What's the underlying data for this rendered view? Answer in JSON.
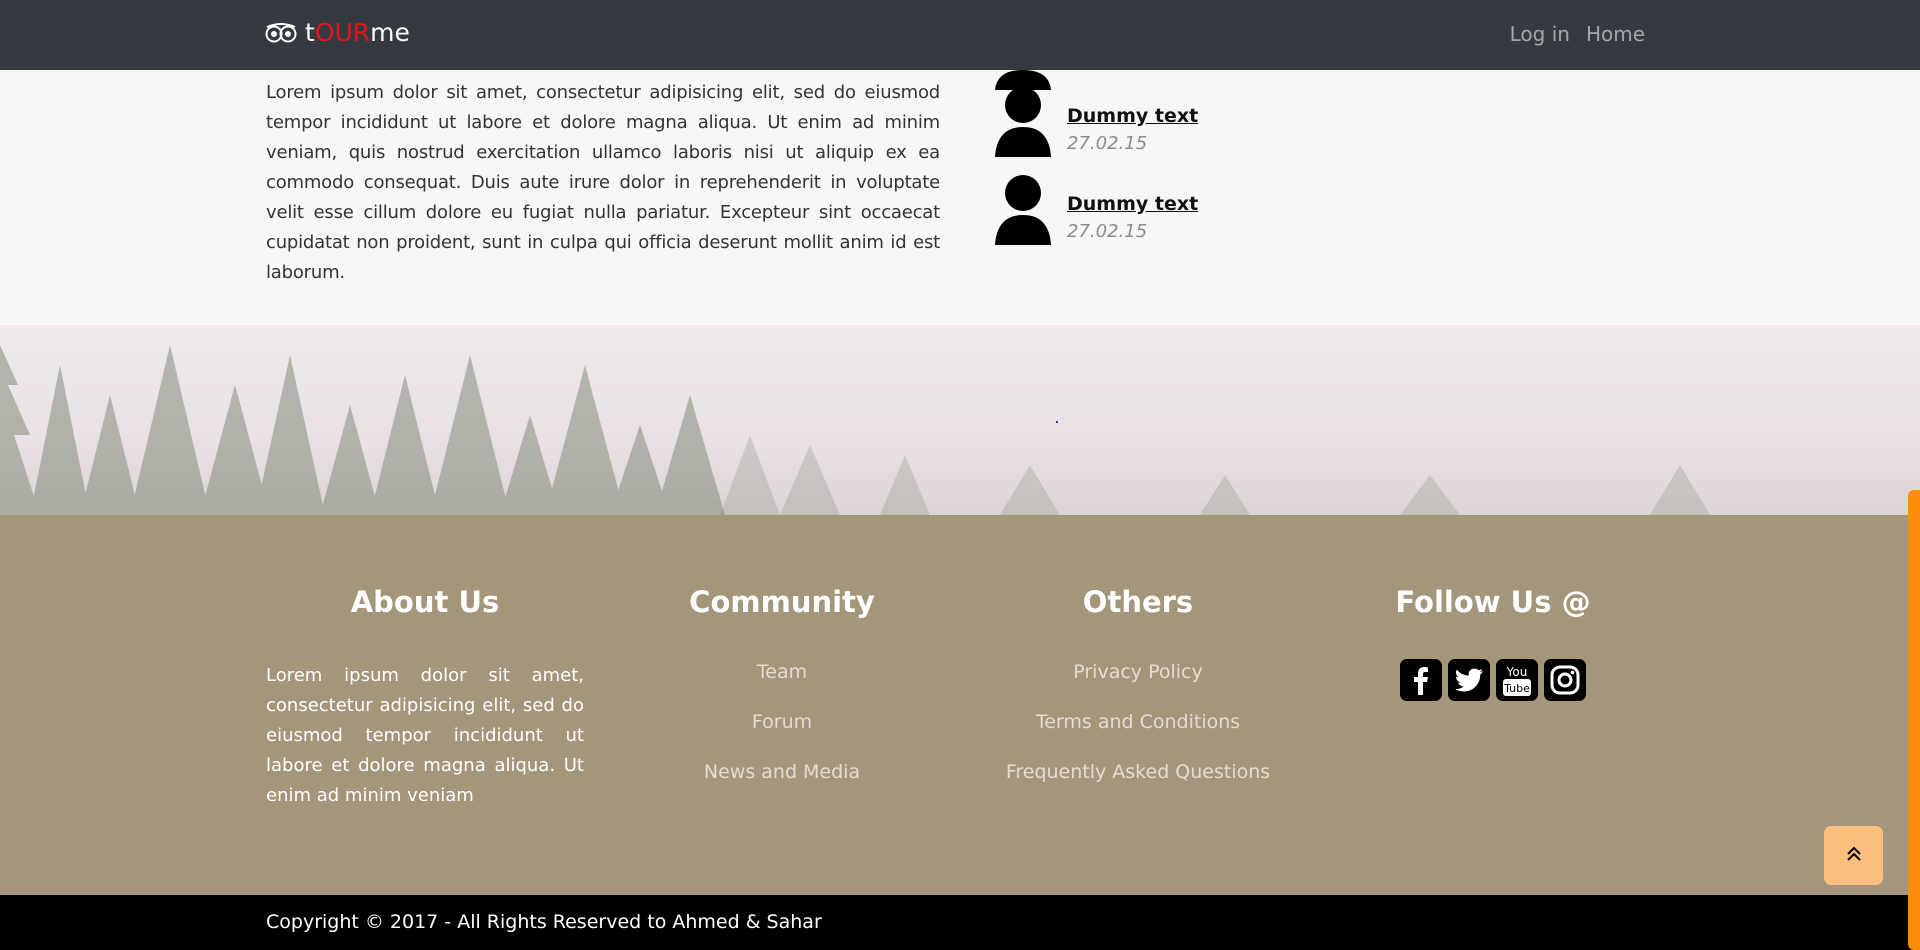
{
  "brand": {
    "prefix": "t",
    "highlight": "OUR",
    "suffix": "me",
    "highlight_color": "#e3141c"
  },
  "nav": {
    "login": "Log in",
    "home": "Home"
  },
  "intro": {
    "paragraph": "Lorem ipsum dolor sit amet, consectetur adipisicing elit, sed do eiusmod tempor incididunt ut labore et dolore magna aliqua. Ut enim ad minim veniam, quis nostrud exercitation ullamco laboris nisi ut aliquip ex ea commodo consequat. Duis aute irure dolor in reprehenderit in voluptate velit esse cillum dolore eu fugiat nulla pariatur. Excepteur sint occaecat cupidatat non proident, sunt in culpa qui officia deserunt mollit anim id est laborum."
  },
  "posts": [
    {
      "title": "Dummy text",
      "date": "27.02.15"
    },
    {
      "title": "Dummy text",
      "date": "27.02.15"
    }
  ],
  "footer": {
    "about": {
      "heading": "About Us",
      "text": "Lorem ipsum dolor sit amet, consectetur adipisicing elit, sed do eiusmod tempor incididunt ut labore et dolore magna aliqua. Ut enim ad minim veniam"
    },
    "community": {
      "heading": "Community",
      "links": [
        "Team",
        "Forum",
        "News and Media"
      ]
    },
    "others": {
      "heading": "Others",
      "links": [
        "Privacy Policy",
        "Terms and Conditions",
        "Frequently Asked Questions"
      ]
    },
    "follow": {
      "heading": "Follow Us @",
      "icons": [
        "facebook-icon",
        "twitter-icon",
        "youtube-icon",
        "instagram-icon"
      ]
    }
  },
  "copyright": "Copyright © 2017 - All Rights Reserved to Ahmed & Sahar",
  "colors": {
    "navbar": "#343a40",
    "footer": "#a3967a",
    "scroll_button": "#fdbf7f",
    "scroll_rail": "#ff8c0a"
  }
}
